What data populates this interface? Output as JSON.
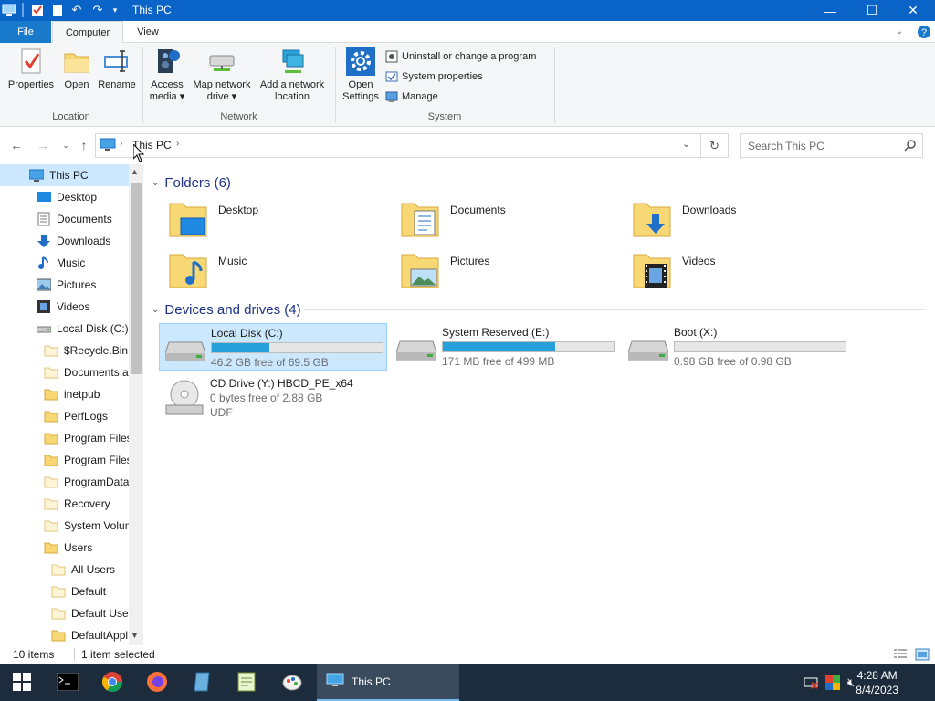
{
  "window": {
    "title": "This PC",
    "buttons": {
      "minimize": "—",
      "maximize": "☐",
      "close": "✕"
    }
  },
  "ribbon_tabs": [
    {
      "label": "File"
    },
    {
      "label": "Computer"
    },
    {
      "label": "View"
    }
  ],
  "ribbon": {
    "location": {
      "label": "Location",
      "buttons": [
        {
          "label": "Properties",
          "icon": "properties-icon"
        },
        {
          "label": "Open",
          "icon": "folder-open-icon"
        },
        {
          "label": "Rename",
          "icon": "rename-icon"
        }
      ]
    },
    "network": {
      "label": "Network",
      "access_media": {
        "line1": "Access",
        "line2": "media ▾"
      },
      "map_drive": {
        "line1": "Map network",
        "line2": "drive ▾"
      },
      "add_location": {
        "line1": "Add a network",
        "line2": "location"
      }
    },
    "system": {
      "label": "System",
      "open_settings": {
        "line1": "Open",
        "line2": "Settings"
      },
      "items": [
        {
          "label": "Uninstall or change a program"
        },
        {
          "label": "System properties"
        },
        {
          "label": "Manage"
        }
      ]
    }
  },
  "address": {
    "crumb": "This PC",
    "search_placeholder": "Search This PC"
  },
  "nav": [
    {
      "label": "This PC",
      "icon": "pc-icon",
      "selected": true
    },
    {
      "label": "Desktop",
      "icon": "desktop-icon"
    },
    {
      "label": "Documents",
      "icon": "documents-icon"
    },
    {
      "label": "Downloads",
      "icon": "downloads-icon"
    },
    {
      "label": "Music",
      "icon": "music-icon"
    },
    {
      "label": "Pictures",
      "icon": "pictures-icon"
    },
    {
      "label": "Videos",
      "icon": "videos-icon"
    },
    {
      "label": "Local Disk (C:)",
      "icon": "drive-icon"
    },
    {
      "label": "$Recycle.Bin",
      "icon": "folder-icon"
    },
    {
      "label": "Documents a",
      "icon": "folder-icon"
    },
    {
      "label": "inetpub",
      "icon": "folder-icon"
    },
    {
      "label": "PerfLogs",
      "icon": "folder-icon"
    },
    {
      "label": "Program Files",
      "icon": "folder-icon"
    },
    {
      "label": "Program Files",
      "icon": "folder-icon"
    },
    {
      "label": "ProgramData",
      "icon": "folder-icon"
    },
    {
      "label": "Recovery",
      "icon": "folder-icon"
    },
    {
      "label": "System Volum",
      "icon": "folder-icon"
    },
    {
      "label": "Users",
      "icon": "folder-icon"
    },
    {
      "label": "All Users",
      "icon": "folder-icon"
    },
    {
      "label": "Default",
      "icon": "folder-icon"
    },
    {
      "label": "Default User",
      "icon": "folder-icon"
    },
    {
      "label": "DefaultAppl",
      "icon": "folder-icon"
    }
  ],
  "folders_section": "Folders (6)",
  "folders": [
    {
      "label": "Desktop",
      "overlay": "desktop"
    },
    {
      "label": "Documents",
      "overlay": "documents"
    },
    {
      "label": "Downloads",
      "overlay": "downloads"
    },
    {
      "label": "Music",
      "overlay": "music"
    },
    {
      "label": "Pictures",
      "overlay": "pictures"
    },
    {
      "label": "Videos",
      "overlay": "videos"
    }
  ],
  "drives_section": "Devices and drives (4)",
  "drives": [
    {
      "name": "Local Disk (C:)",
      "info": "46.2 GB free of 69.5 GB",
      "used_fraction": 0.335,
      "selected": true,
      "type": "hdd"
    },
    {
      "name": "System Reserved (E:)",
      "info": "171 MB free of 499 MB",
      "used_fraction": 0.657,
      "type": "hdd"
    },
    {
      "name": "Boot (X:)",
      "info": "0.98 GB free of 0.98 GB",
      "used_fraction": 0.0,
      "type": "hdd"
    },
    {
      "name": "CD Drive (Y:) HBCD_PE_x64",
      "info": "0 bytes free of 2.88 GB",
      "extra": "UDF",
      "type": "cd"
    }
  ],
  "status": {
    "count": "10 items",
    "selection": "1 item selected"
  },
  "taskbar": {
    "active_label": "This PC",
    "time": "4:28 AM",
    "date": "8/4/2023"
  },
  "colors": {
    "titlebar": "#0a64c8",
    "accent": "#1979ca",
    "selection": "#cce8ff",
    "drive_bar": "#26a0da",
    "folder_yellow": "#f8d775",
    "taskbar": "#1c2c3c"
  }
}
